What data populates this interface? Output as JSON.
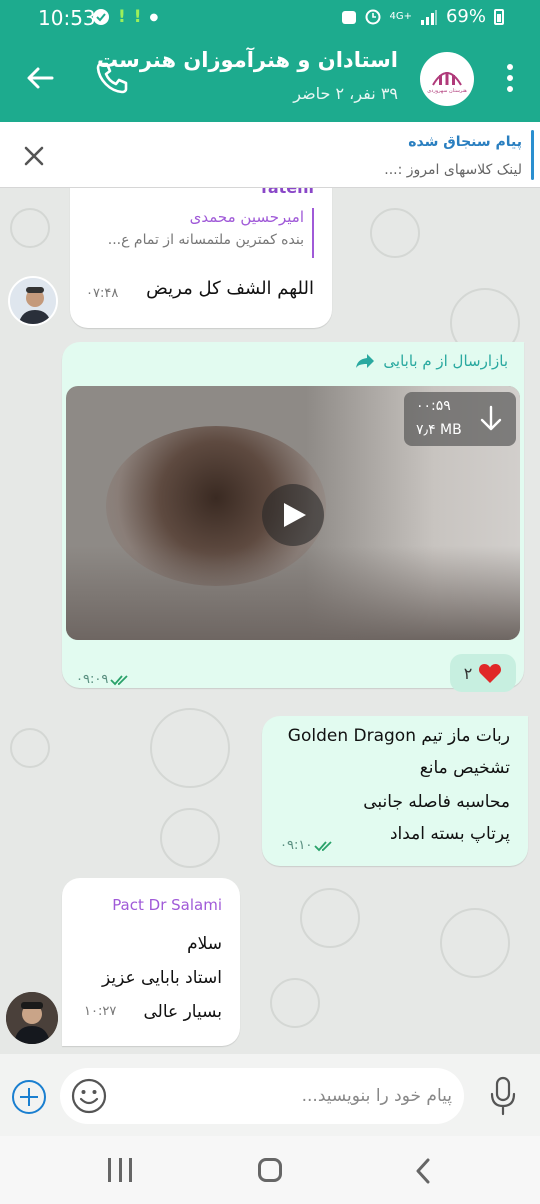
{
  "status_bar": {
    "time": "10:53",
    "network": "4G+",
    "battery": "69%"
  },
  "header": {
    "title": "استادان و هنرآموزان هنرست",
    "subtitle": "۳۹ نفر، ۲ حاضر",
    "avatar_text": "هنرستان سهروردی"
  },
  "pinned": {
    "title": "پیام سنجاق شده",
    "text": "لینک کلاسهای امروز :..."
  },
  "messages": [
    {
      "sender": "fatehi",
      "reply_name": "امیرحسین محمدی",
      "reply_text": "بنده کمترین ملتمسانه از تمام ع...",
      "text": "اللهم الشف کل مریض",
      "time": "۰۷:۴۸"
    },
    {
      "forwarded_from": "بازارسال از م بابایی",
      "video_duration": "۰۰:۵۹",
      "video_size": "۷٫۴ MB",
      "reaction_count": "۲",
      "time": "۰۹:۰۹"
    },
    {
      "lines": [
        "ربات ماز تیم Golden Dragon",
        "تشخیص مانع",
        "محاسبه فاصله جانبی",
        "پرتاپ بسته امداد"
      ],
      "time": "۰۹:۱۰"
    },
    {
      "sender": "Pact Dr Salami",
      "lines": [
        "سلام",
        "استاد بابایی عزیز",
        "بسیار عالی"
      ],
      "time": "۱۰:۲۷"
    }
  ],
  "input": {
    "placeholder": "پیام خود را بنویسید..."
  },
  "colors": {
    "header": "#1dab8e",
    "outgoing_bubble": "#e2fbf0",
    "incoming_bubble": "#ffffff",
    "sender_name": "#8a47c8",
    "pinned_title": "#2a7fc0"
  }
}
